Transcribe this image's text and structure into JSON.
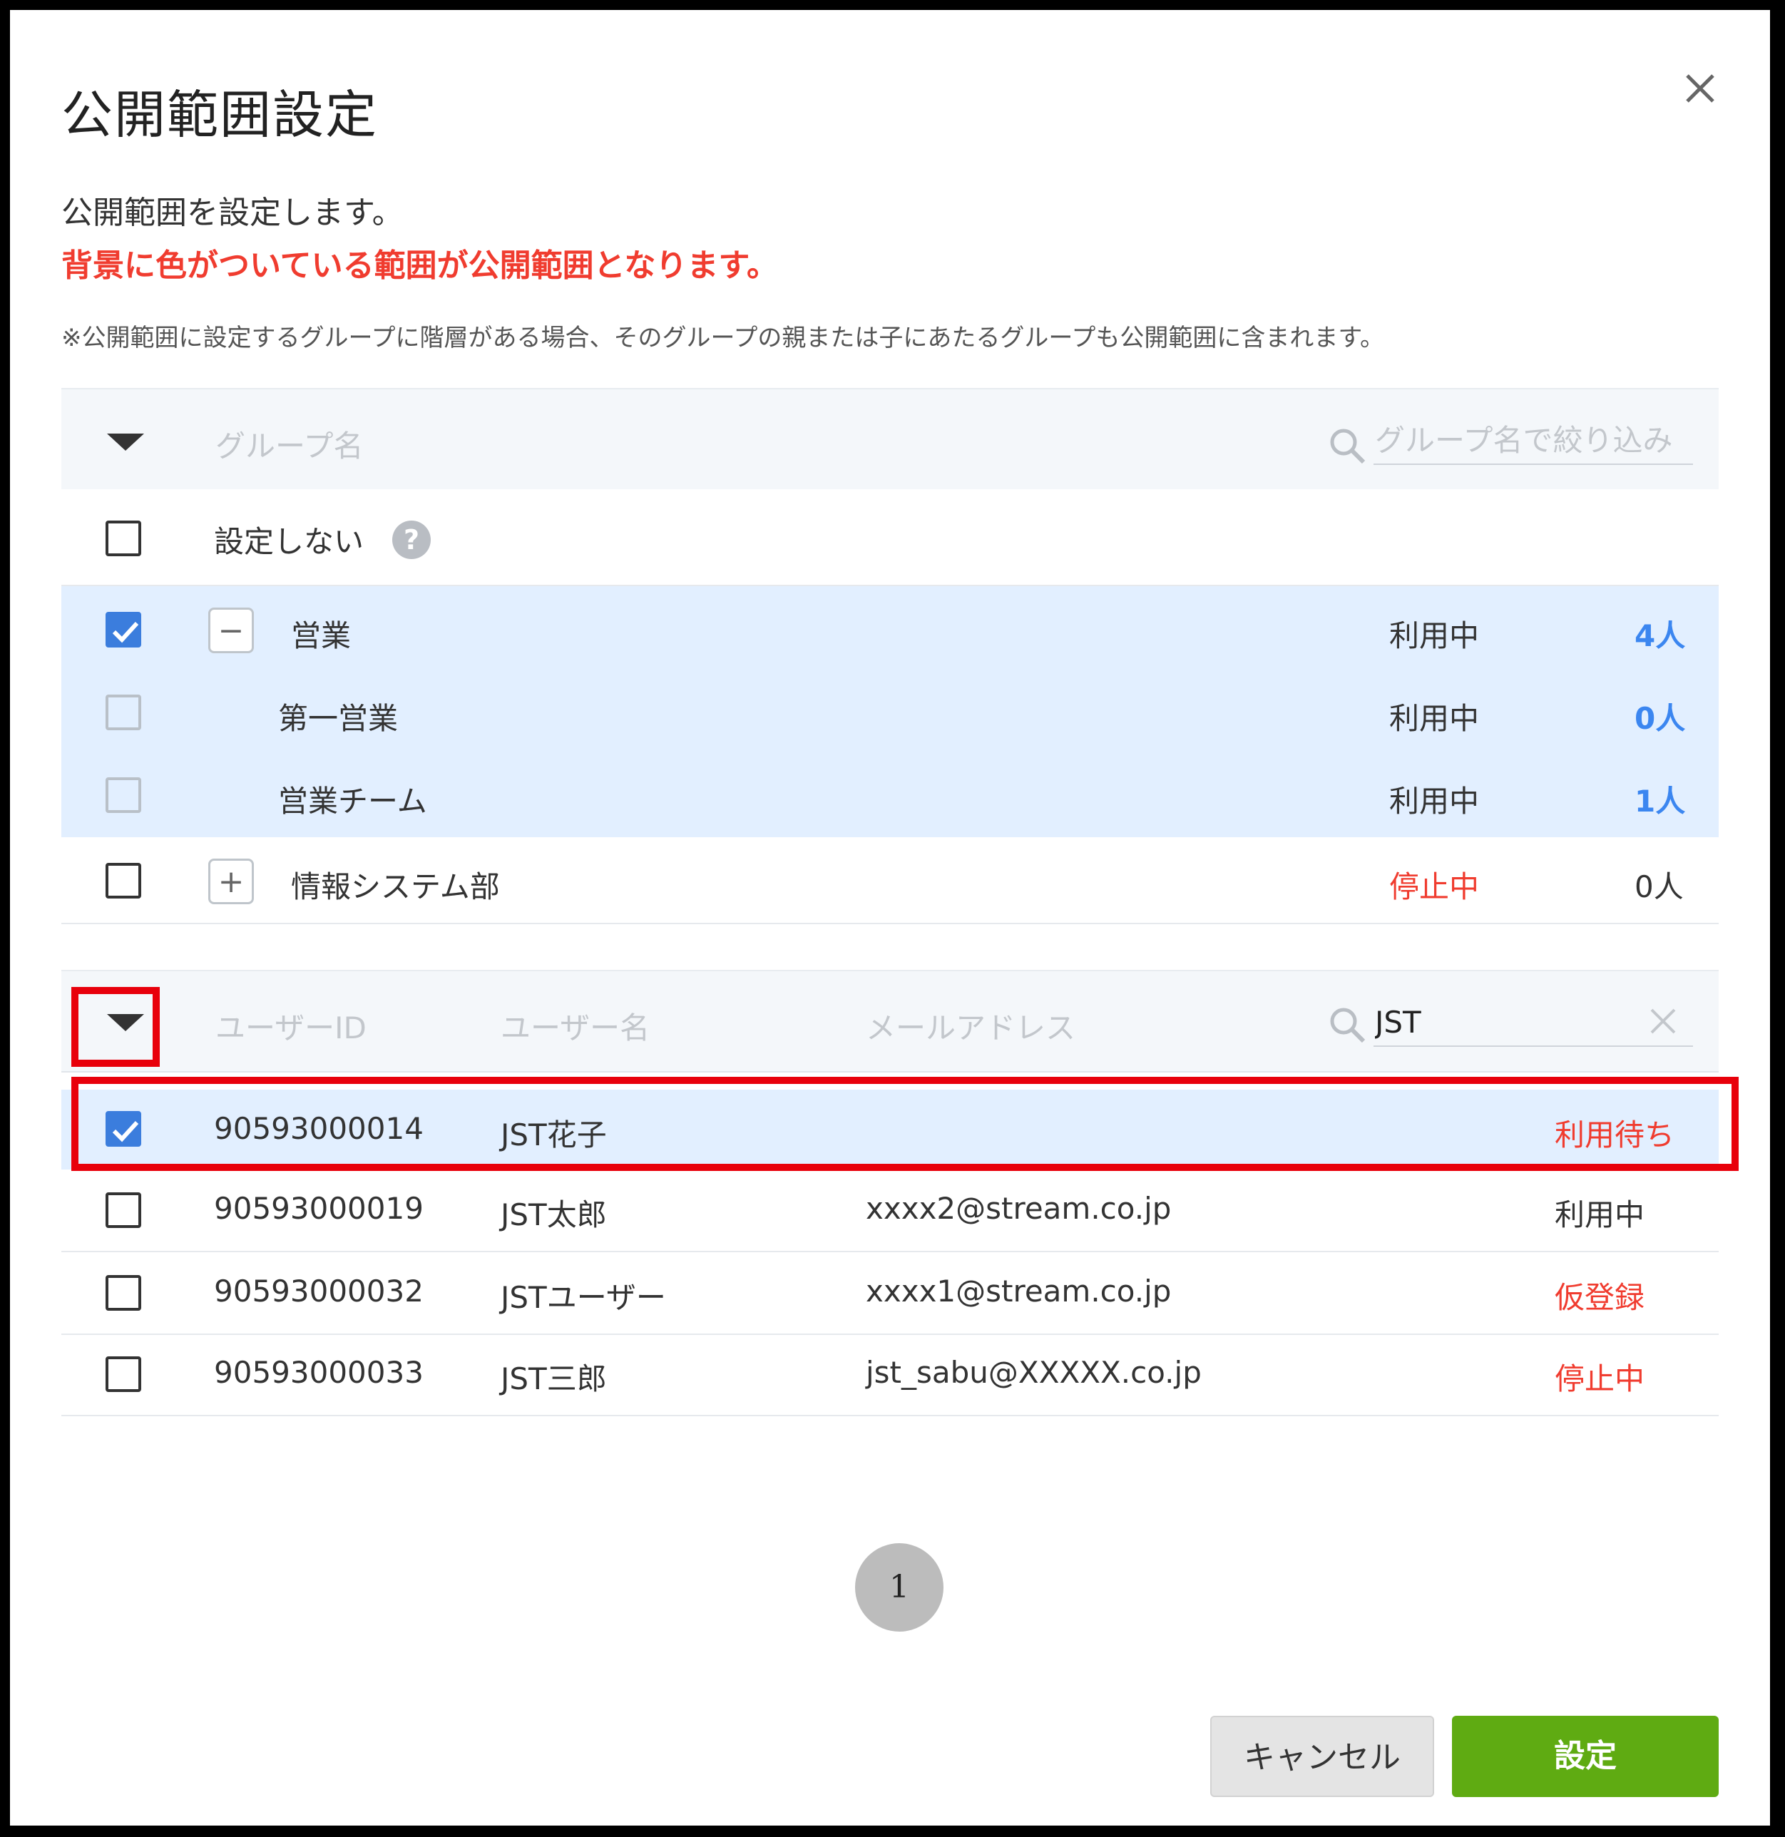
{
  "dialog": {
    "title": "公開範囲設定",
    "description": "公開範囲を設定します。",
    "highlight_text": "背景に色がついている範囲が公開範囲となります。",
    "note": "※公開範囲に設定するグループに階層がある場合、そのグループの親または子にあたるグループも公開範囲に含まれます。"
  },
  "groups": {
    "header": {
      "col_name": "グループ名",
      "search_placeholder": "グループ名で絞り込み"
    },
    "none_option": {
      "label": "設定しない",
      "help_glyph": "?"
    },
    "rows": [
      {
        "name": "営業",
        "status": "利用中",
        "count": "4人",
        "checked": true,
        "toggle": "−",
        "selected": true
      },
      {
        "name": "第一営業",
        "status": "利用中",
        "count": "0人",
        "checked": false,
        "selected": true
      },
      {
        "name": "営業チーム",
        "status": "利用中",
        "count": "1人",
        "checked": false,
        "selected": true
      },
      {
        "name": "情報システム部",
        "status": "停止中",
        "count": "0人",
        "checked": false,
        "toggle": "+",
        "selected": false
      }
    ]
  },
  "users": {
    "header": {
      "col_id": "ユーザーID",
      "col_name": "ユーザー名",
      "col_email": "メールアドレス",
      "search_value": "JST"
    },
    "rows": [
      {
        "id": "90593000014",
        "name": "JST花子",
        "email": "",
        "status": "利用待ち",
        "checked": true
      },
      {
        "id": "90593000019",
        "name": "JST太郎",
        "email": "xxxx2@stream.co.jp",
        "status": "利用中",
        "checked": false
      },
      {
        "id": "90593000032",
        "name": "JSTユーザー",
        "email": "xxxx1@stream.co.jp",
        "status": "仮登録",
        "checked": false
      },
      {
        "id": "90593000033",
        "name": "JST三郎",
        "email": "jst_sabu@XXXXX.co.jp",
        "status": "停止中",
        "checked": false
      }
    ]
  },
  "pagination": {
    "current": "1"
  },
  "buttons": {
    "cancel": "キャンセル",
    "submit": "設定"
  },
  "colors": {
    "accent_blue": "#3b7ddd",
    "alert_red": "#f03c2f",
    "submit_green": "#5fab12",
    "highlight_box": "#e8000b",
    "selected_bg": "#e2efff"
  },
  "icons": [
    "close-icon",
    "caret-down-icon",
    "search-icon",
    "check-icon",
    "help-icon",
    "minus-icon",
    "plus-icon",
    "clear-icon"
  ]
}
